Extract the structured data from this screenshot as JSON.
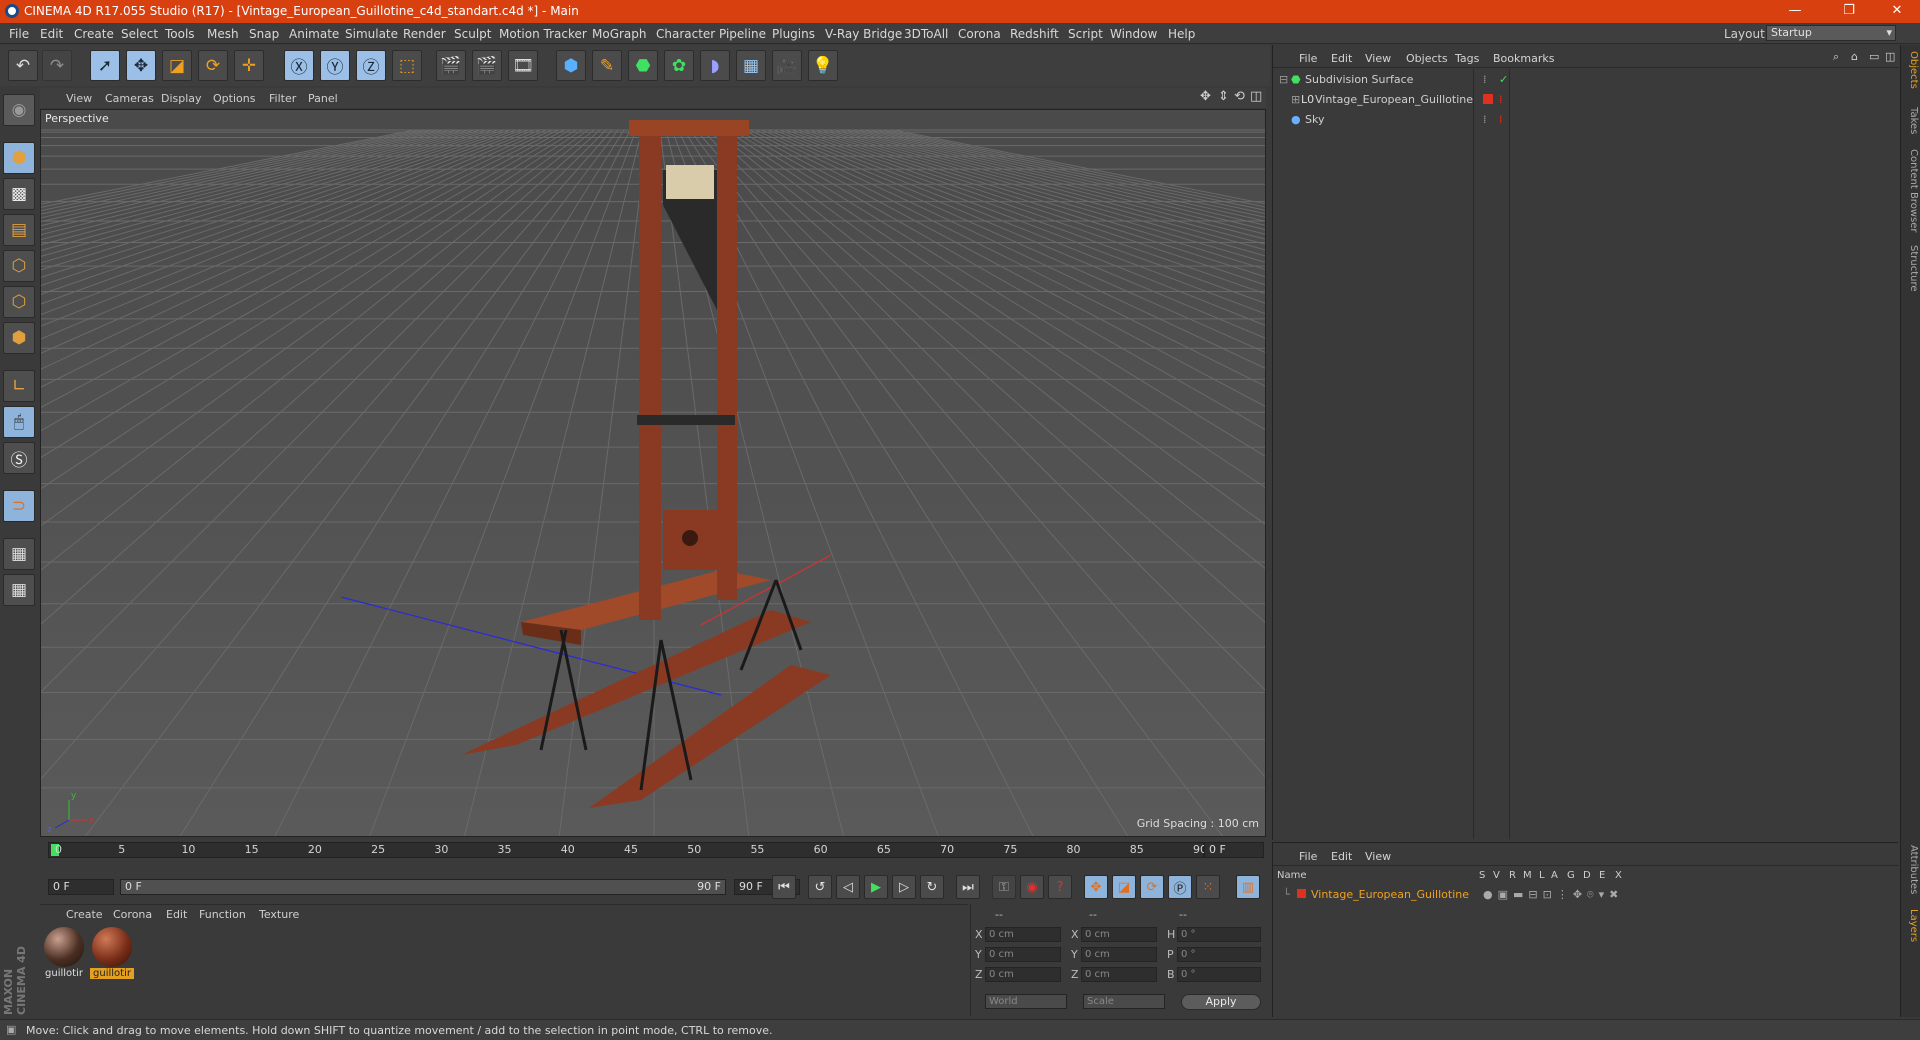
{
  "window": {
    "title": "CINEMA 4D R17.055 Studio (R17) - [Vintage_European_Guillotine_c4d_standart.c4d *] - Main",
    "controls": [
      "—",
      "❐",
      "✕"
    ]
  },
  "menu": [
    "File",
    "Edit",
    "Create",
    "Select",
    "Tools",
    "Mesh",
    "Snap",
    "Animate",
    "Simulate",
    "Render",
    "Sculpt",
    "Motion Tracker",
    "MoGraph",
    "Character",
    "Pipeline",
    "Plugins",
    "V-Ray Bridge",
    "3DToAll",
    "Corona",
    "Redshift",
    "Script",
    "Window",
    "Help"
  ],
  "layout": {
    "label": "Layout:",
    "value": "Startup"
  },
  "viewport": {
    "menu": [
      "View",
      "Cameras",
      "Display",
      "Options",
      "Filter",
      "Panel"
    ],
    "label": "Perspective",
    "grid_info": "Grid Spacing : 100 cm",
    "axis": {
      "y": "y",
      "x": "x",
      "z": "z"
    }
  },
  "timeline": {
    "ticks": [
      "0",
      "5",
      "10",
      "15",
      "20",
      "25",
      "30",
      "35",
      "40",
      "45",
      "50",
      "55",
      "60",
      "65",
      "70",
      "75",
      "80",
      "85",
      "90"
    ],
    "current_frame": "0 F",
    "start": "0 F",
    "range_start": "0 F",
    "range_end": "90 F",
    "end": "90 F"
  },
  "materials": {
    "menu": [
      "Create",
      "Corona",
      "Edit",
      "Function",
      "Texture"
    ],
    "items": [
      {
        "name": "guillotir",
        "color": "#4a2e22",
        "selected": false
      },
      {
        "name": "guillotir",
        "color": "#7a2e18",
        "selected": true
      }
    ]
  },
  "coords": {
    "headers": [
      "--",
      "--",
      "--"
    ],
    "rows": [
      {
        "l1": "X",
        "v1": "0 cm",
        "l2": "X",
        "v2": "0 cm",
        "l3": "H",
        "v3": "0 °"
      },
      {
        "l1": "Y",
        "v1": "0 cm",
        "l2": "Y",
        "v2": "0 cm",
        "l3": "P",
        "v3": "0 °"
      },
      {
        "l1": "Z",
        "v1": "0 cm",
        "l2": "Z",
        "v2": "0 cm",
        "l3": "B",
        "v3": "0 °"
      }
    ],
    "world": "World",
    "scale": "Scale",
    "apply": "Apply"
  },
  "objects": {
    "menu": [
      "File",
      "Edit",
      "View",
      "Objects",
      "Tags",
      "Bookmarks"
    ],
    "items": [
      {
        "name": "Subdivision Surface",
        "indent": 0
      },
      {
        "name": "Vintage_European_Guillotine",
        "indent": 1
      },
      {
        "name": "Sky",
        "indent": 0
      }
    ]
  },
  "layers": {
    "menu": [
      "File",
      "Edit",
      "View"
    ],
    "name_header": "Name",
    "cols": [
      "S",
      "V",
      "R",
      "M",
      "L",
      "A",
      "G",
      "D",
      "E",
      "X"
    ],
    "item": "Vintage_European_Guillotine",
    "item_color": "#e03020"
  },
  "right_tabs": [
    "Objects",
    "Takes",
    "Content Browser",
    "Structure",
    "Attributes",
    "Layers"
  ],
  "status": "Move: Click and drag to move elements. Hold down SHIFT to quantize movement / add to the selection in point mode, CTRL to remove.",
  "brand": "MAXON CINEMA 4D"
}
